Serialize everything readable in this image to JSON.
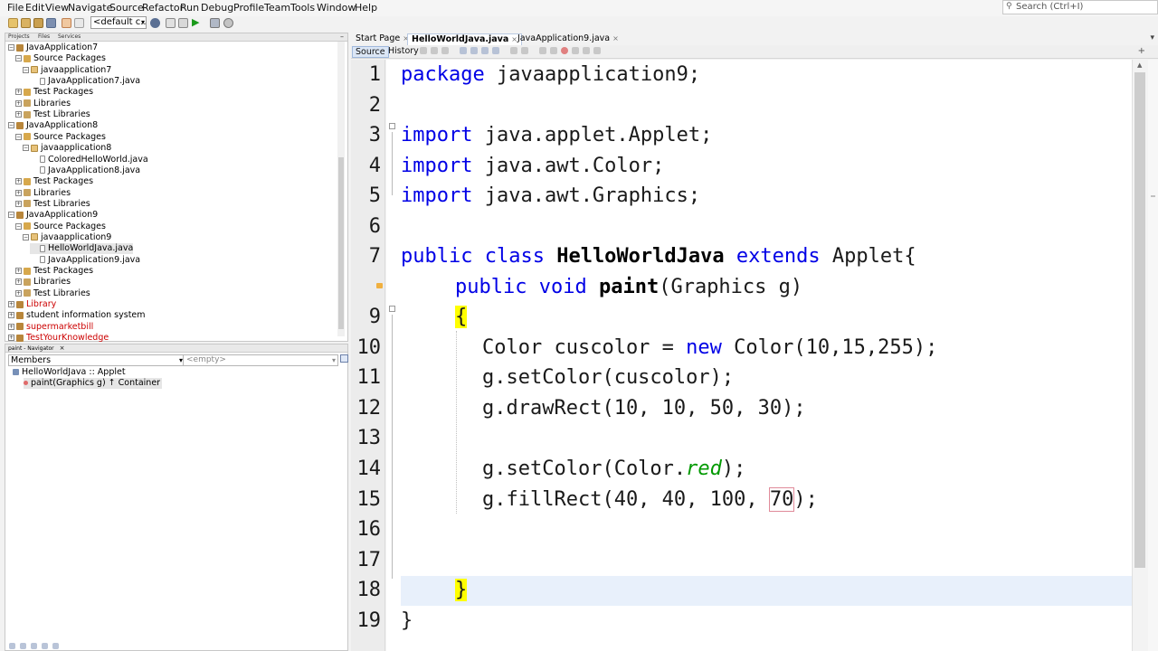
{
  "menu": {
    "items": [
      "File",
      "Edit",
      "View",
      "Navigate",
      "Source",
      "Refactor",
      "Run",
      "Debug",
      "Profile",
      "Team",
      "Tools",
      "Window",
      "Help"
    ],
    "search_placeholder": "Search (Ctrl+I)"
  },
  "toolbar": {
    "config_value": "<default c..."
  },
  "projects_panel": {
    "tabs": [
      "Projects",
      "Files",
      "Services"
    ],
    "tree": [
      {
        "label": "JavaApplication7",
        "level": 0,
        "icon": "project-icon"
      },
      {
        "label": "Source Packages",
        "level": 1,
        "icon": "source-packages-icon"
      },
      {
        "label": "javaapplication7",
        "level": 2,
        "icon": "package-icon"
      },
      {
        "label": "JavaApplication7.java",
        "level": 3,
        "icon": "java-file-icon"
      },
      {
        "label": "Test Packages",
        "level": 1,
        "icon": "test-packages-icon"
      },
      {
        "label": "Libraries",
        "level": 1,
        "icon": "libraries-icon"
      },
      {
        "label": "Test Libraries",
        "level": 1,
        "icon": "test-libraries-icon"
      },
      {
        "label": "JavaApplication8",
        "level": 0,
        "icon": "project-icon"
      },
      {
        "label": "Source Packages",
        "level": 1,
        "icon": "source-packages-icon"
      },
      {
        "label": "javaapplication8",
        "level": 2,
        "icon": "package-icon"
      },
      {
        "label": "ColoredHelloWorld.java",
        "level": 3,
        "icon": "java-file-icon"
      },
      {
        "label": "JavaApplication8.java",
        "level": 3,
        "icon": "java-file-icon"
      },
      {
        "label": "Test Packages",
        "level": 1,
        "icon": "test-packages-icon"
      },
      {
        "label": "Libraries",
        "level": 1,
        "icon": "libraries-icon"
      },
      {
        "label": "Test Libraries",
        "level": 1,
        "icon": "test-libraries-icon"
      },
      {
        "label": "JavaApplication9",
        "level": 0,
        "icon": "project-icon"
      },
      {
        "label": "Source Packages",
        "level": 1,
        "icon": "source-packages-icon"
      },
      {
        "label": "javaapplication9",
        "level": 2,
        "icon": "package-icon"
      },
      {
        "label": "HelloWorldJava.java",
        "level": 3,
        "icon": "java-file-icon"
      },
      {
        "label": "JavaApplication9.java",
        "level": 3,
        "icon": "java-file-icon"
      },
      {
        "label": "Test Packages",
        "level": 1,
        "icon": "test-packages-icon"
      },
      {
        "label": "Libraries",
        "level": 1,
        "icon": "libraries-icon"
      },
      {
        "label": "Test Libraries",
        "level": 1,
        "icon": "test-libraries-icon"
      },
      {
        "label": "Library",
        "level": 0,
        "icon": "project-icon",
        "color": "#cc0000"
      },
      {
        "label": "student information system",
        "level": 0,
        "icon": "project-icon"
      },
      {
        "label": "supermarketbill",
        "level": 0,
        "icon": "project-icon",
        "color": "#cc0000"
      },
      {
        "label": "TestYourKnowledge",
        "level": 0,
        "icon": "project-icon",
        "color": "#cc0000"
      }
    ]
  },
  "navigator": {
    "tab": "paint - Navigator",
    "members_label": "Members",
    "filter_value": "<empty>",
    "class_entry": "HelloWorldJava :: Applet",
    "method_entry": "paint(Graphics g) ↑ Container"
  },
  "editor": {
    "tabs": [
      "Start Page",
      "HelloWorldJava.java",
      "JavaApplication9.java"
    ],
    "active_tab": "HelloWorldJava.java",
    "view_tabs": [
      "Source",
      "History"
    ],
    "line_numbers": [
      "1",
      "2",
      "3",
      "4",
      "5",
      "6",
      "7",
      "",
      "9",
      "10",
      "11",
      "12",
      "13",
      "14",
      "15",
      "16",
      "17",
      "18",
      "19"
    ],
    "code": {
      "l1_kw": "package",
      "l1_rest": " javaapplication9;",
      "l3_kw": "import",
      "l3_rest": " java.applet.Applet;",
      "l4_kw": "import",
      "l4_rest": " java.awt.Color;",
      "l5_kw": "import",
      "l5_rest": " java.awt.Graphics;",
      "l7_kw1": "public",
      "l7_kw2": " class ",
      "l7_name": "HelloWorldJava",
      "l7_kw3": " extends",
      "l7_rest": " Applet{",
      "l8_kw1": "public",
      "l8_kw2": " void ",
      "l8_name": "paint",
      "l8_rest": "(Graphics g)",
      "l9_brace": "{",
      "l10_a": "Color cuscolor = ",
      "l10_kw": "new",
      "l10_b": " Color(10,15,255);",
      "l11": "g.setColor(cuscolor);",
      "l12": "g.drawRect(10, 10, 50, 30);",
      "l14_a": "g.setColor(Color.",
      "l14_it": "red",
      "l14_b": ");",
      "l15_a": "g.fillRect(40, 40, 100, ",
      "l15_box": "70",
      "l15_b": ");",
      "l18_brace": "}",
      "l19": "}"
    }
  },
  "colors": {
    "keyword": "#0000e6",
    "field": "#009900",
    "brace_highlight": "#ffff00",
    "error_project": "#cc0000"
  }
}
